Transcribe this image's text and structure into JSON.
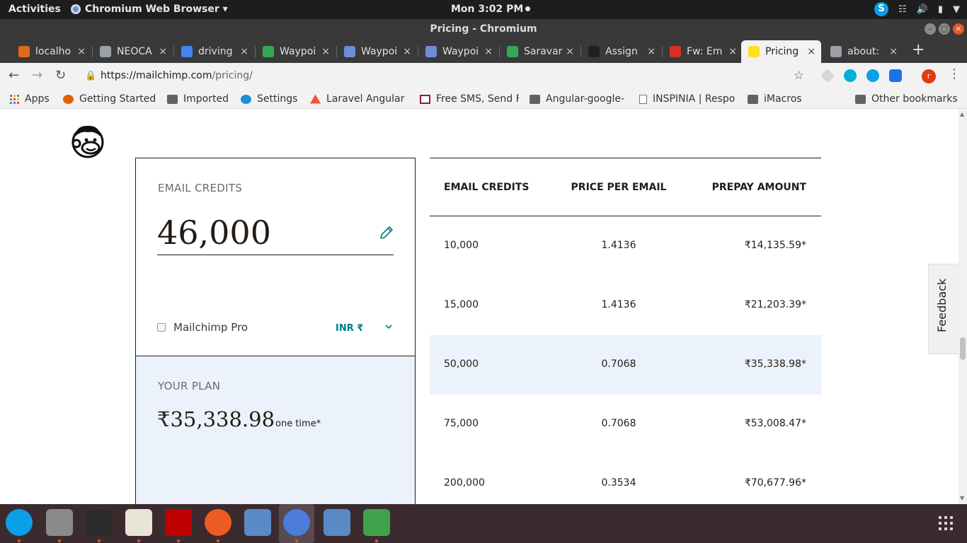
{
  "system": {
    "activities": "Activities",
    "app_name": "Chromium Web Browser ▾",
    "clock": "Mon  3:02 PM"
  },
  "window": {
    "title": "Pricing - Chromium"
  },
  "tabs": [
    {
      "label": "localho",
      "color": "#e06b1a"
    },
    {
      "label": "NEOCA",
      "color": "#9aa0a6"
    },
    {
      "label": "driving",
      "color": "#4285f4"
    },
    {
      "label": "Waypoi",
      "color": "#34a853"
    },
    {
      "label": "Waypoi",
      "color": "#6b8fd6"
    },
    {
      "label": "Waypoi",
      "color": "#6b8fd6"
    },
    {
      "label": "Saravar",
      "color": "#34a853"
    },
    {
      "label": "Assign",
      "color": "#202020"
    },
    {
      "label": "Fw: Em",
      "color": "#d93025"
    },
    {
      "label": "Pricing",
      "color": "#ffe01b"
    },
    {
      "label": "about:",
      "color": "#9aa0a6"
    }
  ],
  "toolbar": {
    "url_host": "https://mailchimp.com",
    "url_path": "/pricing/",
    "profile_initial": "r"
  },
  "bookmarks": [
    {
      "label": "Apps",
      "icon": "apps-grid-icon"
    },
    {
      "label": "Getting Started",
      "icon": "firefox-icon"
    },
    {
      "label": "Imported",
      "icon": "folder-icon"
    },
    {
      "label": "Settings",
      "icon": "settings-icon"
    },
    {
      "label": "Laravel Angular",
      "icon": "laravel-icon"
    },
    {
      "label": "Free SMS, Send F",
      "icon": "sms-icon"
    },
    {
      "label": "Angular-google-",
      "icon": "folder-icon"
    },
    {
      "label": "INSPINIA | Respo",
      "icon": "page-icon"
    },
    {
      "label": "iMacros",
      "icon": "folder-icon"
    },
    {
      "label": "Other bookmarks",
      "icon": "folder-icon"
    }
  ],
  "calculator": {
    "credits_label": "EMAIL CREDITS",
    "credits_value": "46,000",
    "pro_label": "Mailchimp Pro",
    "pro_checked": false,
    "currency": "INR ₹",
    "plan_label": "YOUR PLAN",
    "plan_price": "₹35,338.98",
    "plan_note": "one time*"
  },
  "pricing_table": {
    "headers": [
      "EMAIL CREDITS",
      "PRICE PER EMAIL",
      "PREPAY AMOUNT"
    ],
    "rows": [
      [
        "10,000",
        "1.4136",
        "₹14,135.59*"
      ],
      [
        "15,000",
        "1.4136",
        "₹21,203.39*"
      ],
      [
        "50,000",
        "0.7068",
        "₹35,338.98*"
      ],
      [
        "75,000",
        "0.7068",
        "₹53,008.47*"
      ],
      [
        "200,000",
        "0.3534",
        "₹70,677.96*"
      ]
    ],
    "highlighted_row": 2
  },
  "feedback_label": "Feedback",
  "colors": {
    "accent_teal": "#007c89",
    "highlight_row": "#ebf2fb",
    "ink": "#241c15"
  },
  "dock": [
    {
      "name": "skype-icon",
      "running": true
    },
    {
      "name": "files-icon",
      "running": true
    },
    {
      "name": "terminal-icon",
      "running": true
    },
    {
      "name": "text-editor-icon",
      "running": true
    },
    {
      "name": "filezilla-icon",
      "running": true
    },
    {
      "name": "postman-icon",
      "running": true
    },
    {
      "name": "virtualbox-icon",
      "running": false
    },
    {
      "name": "chromium-icon",
      "running": true
    },
    {
      "name": "virtualbox-icon",
      "running": false
    },
    {
      "name": "spreadsheet-icon",
      "running": true
    }
  ]
}
